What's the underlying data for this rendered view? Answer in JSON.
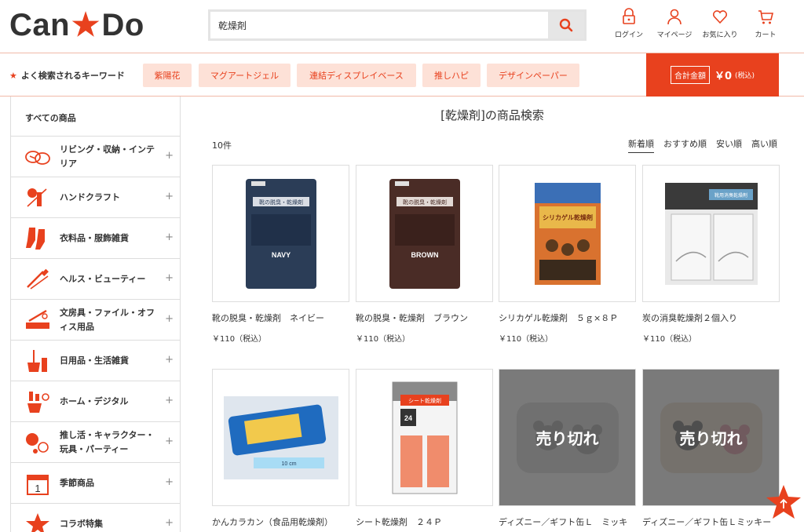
{
  "header": {
    "logo_left": "Can",
    "logo_right": "Do",
    "search_value": "乾燥剤",
    "icons": [
      {
        "label": "ログイン",
        "icon": "lock-icon"
      },
      {
        "label": "マイページ",
        "icon": "user-icon"
      },
      {
        "label": "お気に入り",
        "icon": "heart-icon"
      },
      {
        "label": "カート",
        "icon": "cart-icon"
      }
    ]
  },
  "keywords": {
    "label": "よく検索されるキーワード",
    "items": [
      "紫陽花",
      "マグアートジェル",
      "連結ディスプレイベース",
      "推しハピ",
      "デザインペーパー"
    ]
  },
  "total": {
    "label": "合計金額",
    "value": "￥0",
    "tax": "(税込)"
  },
  "sidebar": {
    "all_label": "すべての商品",
    "items": [
      {
        "label": "リビング・収納・インテリア",
        "icon": "living-icon"
      },
      {
        "label": "ハンドクラフト",
        "icon": "craft-icon"
      },
      {
        "label": "衣料品・服飾雑貨",
        "icon": "socks-icon"
      },
      {
        "label": "ヘルス・ビューティー",
        "icon": "beauty-icon"
      },
      {
        "label": "文房具・ファイル・オフィス用品",
        "icon": "stationery-icon"
      },
      {
        "label": "日用品・生活雑貨",
        "icon": "daily-goods-icon"
      },
      {
        "label": "ホーム・デジタル",
        "icon": "home-digital-icon"
      },
      {
        "label": "推し活・キャラクター・玩具・パーティー",
        "icon": "party-icon"
      },
      {
        "label": "季節商品",
        "icon": "calendar-icon"
      },
      {
        "label": "コラボ特集",
        "icon": "star-icon"
      }
    ],
    "plus": "+"
  },
  "main": {
    "title": "[乾燥剤]の商品検索",
    "count": "10件",
    "sort": [
      "新着順",
      "おすすめ順",
      "安い順",
      "高い順"
    ],
    "active_sort": "新着順",
    "products": [
      {
        "name": "靴の脱臭・乾燥剤　ネイビー",
        "price": "￥110（税込）",
        "sold_out": false,
        "pack_label": "NAVY",
        "pack_title": "靴の脱臭・乾燥剤",
        "color": "#2b3d57"
      },
      {
        "name": "靴の脱臭・乾燥剤　ブラウン",
        "price": "￥110（税込）",
        "sold_out": false,
        "pack_label": "BROWN",
        "pack_title": "靴の脱臭・乾燥剤",
        "color": "#4a2c26"
      },
      {
        "name": "シリカゲル乾燥剤　５ｇ×８Ｐ",
        "price": "￥110（税込）",
        "sold_out": false,
        "pack_label": "シリカゲル乾燥剤",
        "color": "#d9722f"
      },
      {
        "name": "炭の消臭乾燥剤２個入り",
        "price": "￥110（税込）",
        "sold_out": false,
        "pack_label": "靴用消臭乾燥剤",
        "color": "#3a3a3a"
      },
      {
        "name": "かんカラカン（食品用乾燥剤）",
        "price": "",
        "sold_out": false,
        "pack_label": "10 cm",
        "color": "#1f6bbf"
      },
      {
        "name": "シート乾燥剤　２４Ｐ",
        "price": "",
        "sold_out": false,
        "pack_label": "24",
        "pack_title": "シート乾燥剤",
        "color": "#f08c6c"
      },
      {
        "name": "ディズニー／ギフト缶Ｌ　ミッキ",
        "price": "",
        "sold_out": true,
        "sold_label": "売り切れ",
        "color": "#cfcfcf"
      },
      {
        "name": "ディズニー／ギフト缶Ｌミッキー",
        "price": "",
        "sold_out": true,
        "sold_label": "売り切れ",
        "color": "#e9d6c0"
      }
    ]
  },
  "colors": {
    "accent": "#e8411e",
    "keyword_bg": "#fde1d7"
  }
}
